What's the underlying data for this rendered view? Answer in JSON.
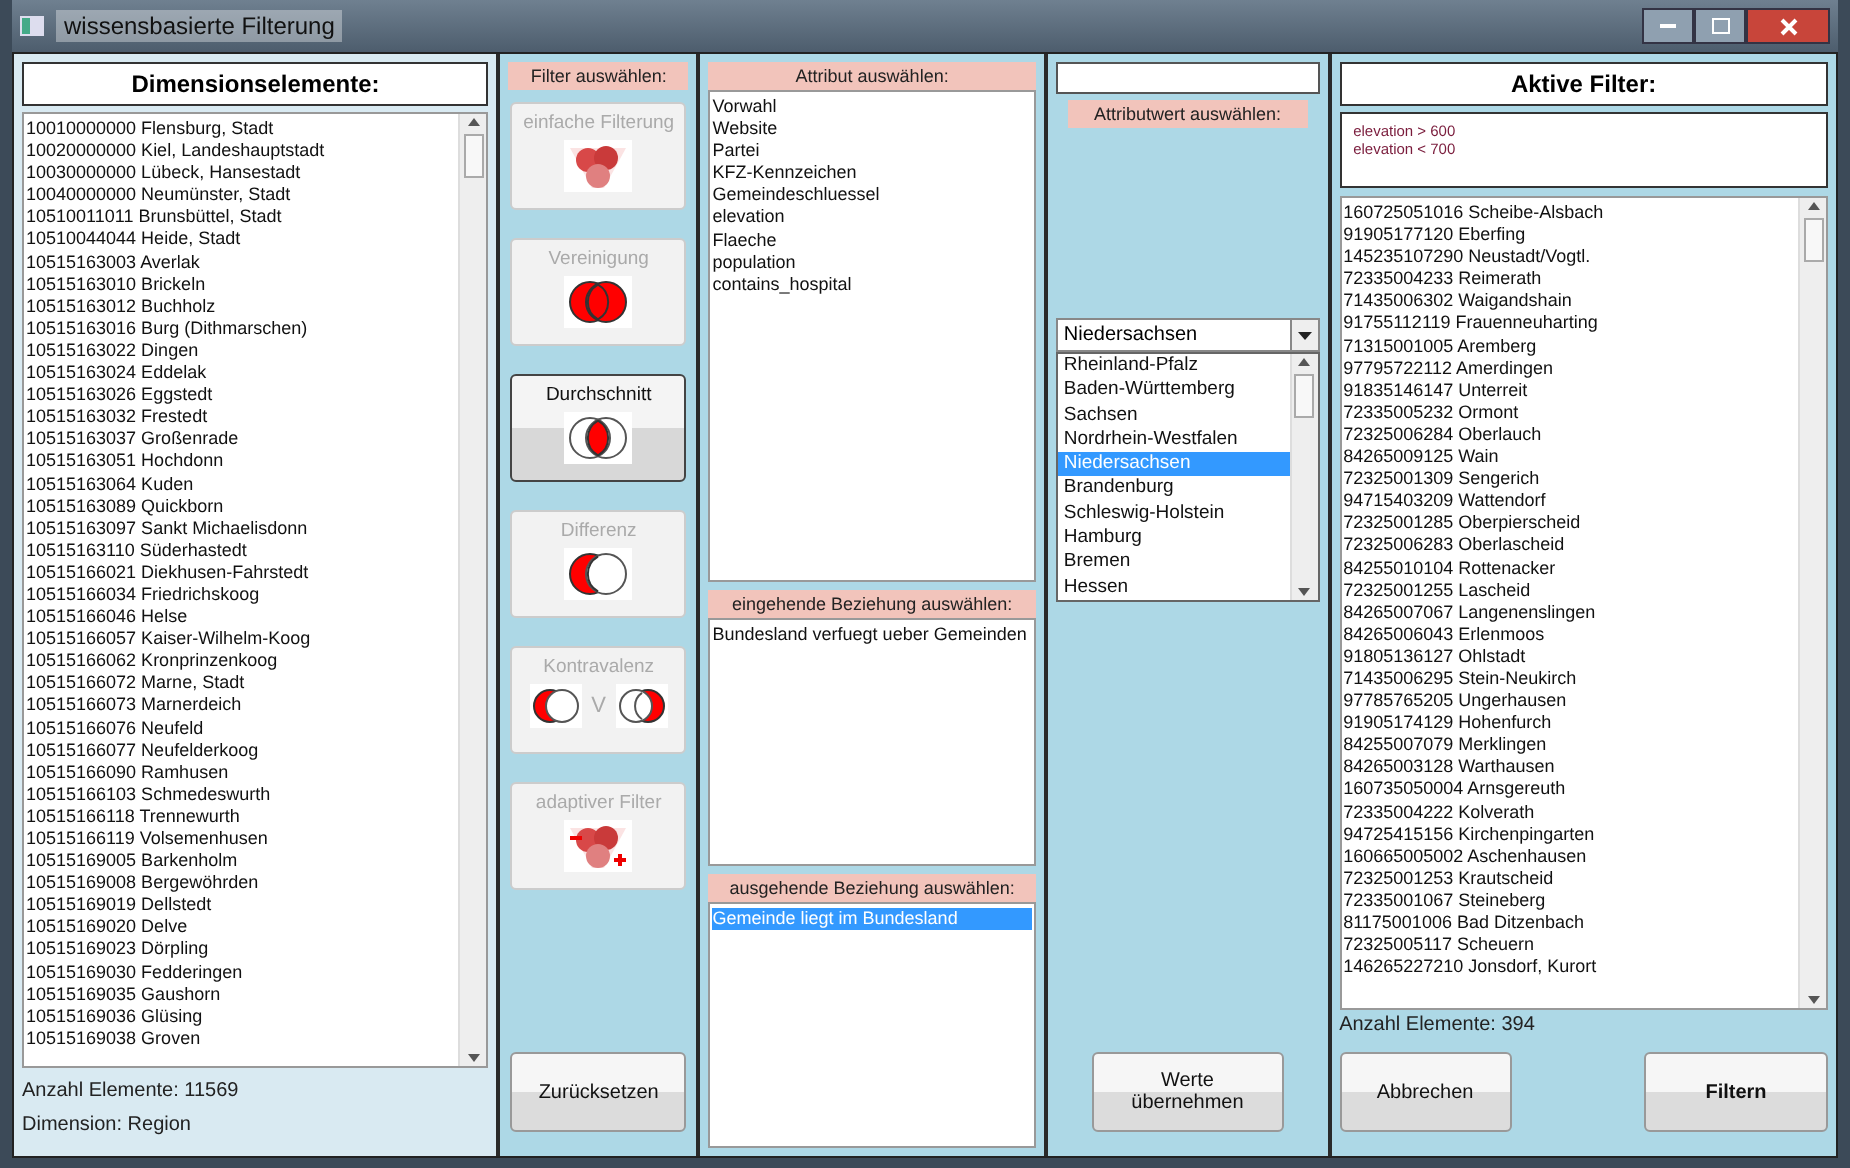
{
  "window": {
    "title": "wissensbasierte Filterung"
  },
  "dimension_panel": {
    "heading": "Dimensionselemente:",
    "items": [
      "10010000000 Flensburg, Stadt",
      "10020000000 Kiel, Landeshauptstadt",
      "10030000000 Lübeck, Hansestadt",
      "10040000000 Neumünster, Stadt",
      "10510011011 Brunsbüttel, Stadt",
      "10510044044 Heide, Stadt",
      "10515163003 Averlak",
      "10515163010 Brickeln",
      "10515163012 Buchholz",
      "10515163016 Burg (Dithmarschen)",
      "10515163022 Dingen",
      "10515163024 Eddelak",
      "10515163026 Eggstedt",
      "10515163032 Frestedt",
      "10515163037 Großenrade",
      "10515163051 Hochdonn",
      "10515163064 Kuden",
      "10515163089 Quickborn",
      "10515163097 Sankt Michaelisdonn",
      "10515163110 Süderhastedt",
      "10515166021 Diekhusen-Fahrstedt",
      "10515166034 Friedrichskoog",
      "10515166046 Helse",
      "10515166057 Kaiser-Wilhelm-Koog",
      "10515166062 Kronprinzenkoog",
      "10515166072 Marne, Stadt",
      "10515166073 Marnerdeich",
      "10515166076 Neufeld",
      "10515166077 Neufelderkoog",
      "10515166090 Ramhusen",
      "10515166103 Schmedeswurth",
      "10515166118 Trennewurth",
      "10515166119 Volsemenhusen",
      "10515169005 Barkenholm",
      "10515169008 Bergewöhrden",
      "10515169019 Dellstedt",
      "10515169020 Delve",
      "10515169023 Dörpling",
      "10515169030 Fedderingen",
      "10515169035 Gaushorn",
      "10515169036 Glüsing",
      "10515169038 Groven"
    ],
    "count": "Anzahl Elemente: 11569",
    "dimension": "Dimension: Region"
  },
  "filter_panel": {
    "heading": "Filter auswählen:",
    "filters": [
      {
        "label": "einfache Filterung",
        "kind": "funnel",
        "selected": false,
        "disabled": true
      },
      {
        "label": "Vereinigung",
        "kind": "union",
        "selected": false,
        "disabled": true
      },
      {
        "label": "Durchschnitt",
        "kind": "intersection",
        "selected": true,
        "disabled": false
      },
      {
        "label": "Differenz",
        "kind": "difference",
        "selected": false,
        "disabled": true
      },
      {
        "label": "Kontravalenz",
        "kind": "xor",
        "selected": false,
        "disabled": true,
        "separator": "V"
      },
      {
        "label": "adaptiver Filter",
        "kind": "adaptive",
        "selected": false,
        "disabled": true
      }
    ],
    "reset_button": "Zurücksetzen"
  },
  "attribute_panel": {
    "heading": "Attribut auswählen:",
    "attributes": [
      {
        "label": "Vorwahl",
        "selected": false
      },
      {
        "label": "Website",
        "selected": false
      },
      {
        "label": "Partei",
        "selected": false
      },
      {
        "label": "KFZ-Kennzeichen",
        "selected": false
      },
      {
        "label": "Gemeindeschluessel",
        "selected": false
      },
      {
        "label": "elevation",
        "selected": false
      },
      {
        "label": "Flaeche",
        "selected": false
      },
      {
        "label": "population",
        "selected": false
      },
      {
        "label": "contains_hospital",
        "selected": false
      }
    ],
    "incoming_heading": "eingehende Beziehung auswählen:",
    "incoming": [
      {
        "label": "Bundesland verfuegt ueber Gemeinden",
        "selected": false
      }
    ],
    "outgoing_heading": "ausgehende Beziehung auswählen:",
    "outgoing": [
      {
        "label": "Gemeinde liegt im Bundesland",
        "selected": true
      }
    ]
  },
  "value_panel": {
    "heading": "Attributwert auswählen:",
    "combo": {
      "value": "Niedersachsen"
    },
    "options": [
      {
        "label": "Rheinland-Pfalz",
        "selected": false
      },
      {
        "label": "Baden-Württemberg",
        "selected": false
      },
      {
        "label": "Sachsen",
        "selected": false
      },
      {
        "label": "Nordrhein-Westfalen",
        "selected": false
      },
      {
        "label": "Niedersachsen",
        "selected": true
      },
      {
        "label": "Brandenburg",
        "selected": false
      },
      {
        "label": "Schleswig-Holstein",
        "selected": false
      },
      {
        "label": "Hamburg",
        "selected": false
      },
      {
        "label": "Bremen",
        "selected": false
      },
      {
        "label": "Hessen",
        "selected": false
      }
    ],
    "apply_button": "Werte übernehmen"
  },
  "active_panel": {
    "heading": "Aktive Filter:",
    "conditions": [
      "elevation > 600",
      "elevation < 700"
    ],
    "results": [
      "160725051016 Scheibe-Alsbach",
      "91905177120 Eberfing",
      "145235107290 Neustadt/Vogtl.",
      "72335004233 Reimerath",
      "71435006302 Waigandshain",
      "91755112119 Frauenneuharting",
      "71315001005 Aremberg",
      "97795722112 Amerdingen",
      "91835146147 Unterreit",
      "72335005232 Ormont",
      "72325006284 Oberlauch",
      "84265009125 Wain",
      "72325001309 Sengerich",
      "94715403209 Wattendorf",
      "72325001285 Oberpierscheid",
      "72325006283 Oberlascheid",
      "84255010104 Rottenacker",
      "72325001255 Lascheid",
      "84265007067 Langenenslingen",
      "84265006043 Erlenmoos",
      "91805136127 Ohlstadt",
      "71435006295 Stein-Neukirch",
      "97785765205 Ungerhausen",
      "91905174129 Hohenfurch",
      "84255007079 Merklingen",
      "84265003128 Warthausen",
      "160735050004 Arnsgereuth",
      "72335004222 Kolverath",
      "94725415156 Kirchenpingarten",
      "160665005002 Aschenhausen",
      "72325001253 Krautscheid",
      "72335001067 Steineberg",
      "81175001006 Bad Ditzenbach",
      "72325005117 Scheuern",
      "146265227210 Jonsdorf, Kurort"
    ],
    "count": "Anzahl Elemente: 394",
    "cancel_button": "Abbrechen",
    "filter_button": "Filtern"
  }
}
